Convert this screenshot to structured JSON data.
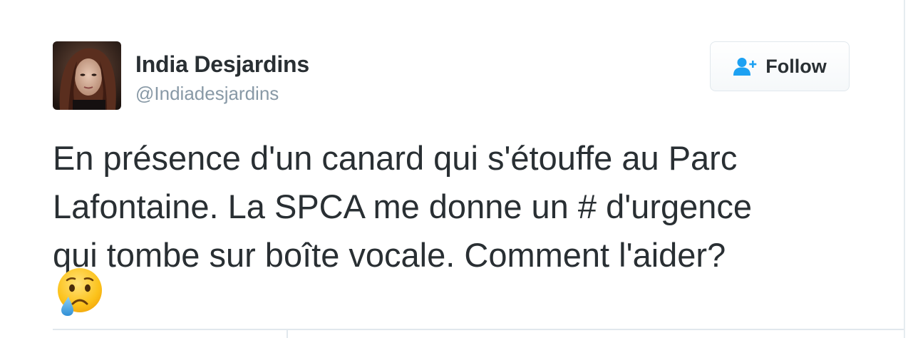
{
  "tweet": {
    "author": {
      "display_name": "India Desjardins",
      "handle": "@Indiadesjardins",
      "avatar_icon": "profile-photo"
    },
    "follow_button": {
      "label": "Follow",
      "icon": "add-user-icon",
      "accent_color": "#1da1f2"
    },
    "text": "En présence d'un canard qui s'étouffe au Parc\nLafontaine. La SPCA me donne un # d'urgence\nqui tombe sur boîte vocale. Comment l'aider?",
    "emoji": "crying-face"
  }
}
